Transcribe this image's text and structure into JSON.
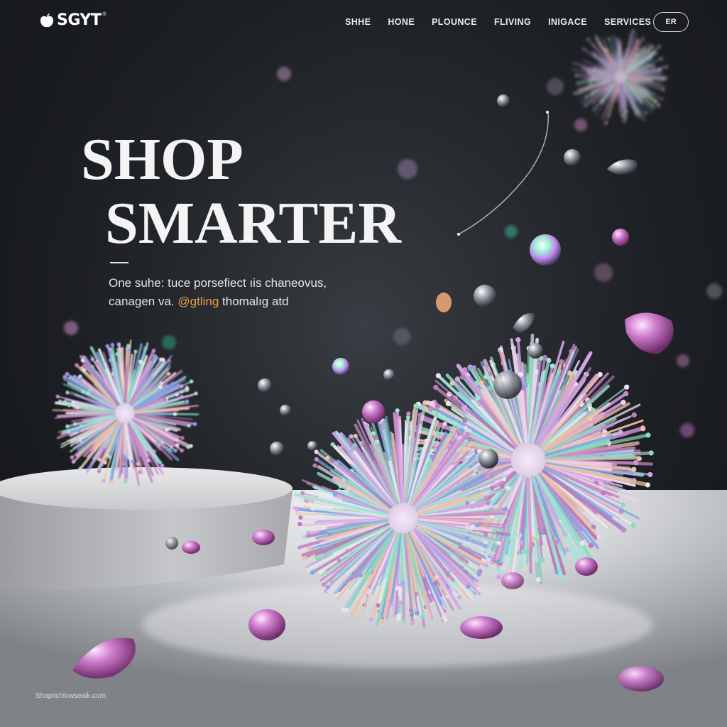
{
  "header": {
    "logo_text": "SGYT",
    "logo_tm": "®",
    "nav": [
      "SHHE",
      "HONE",
      "PLOUNCE",
      "FLIVING",
      "INIGACE",
      "SERVICES"
    ],
    "cta_label": "ER"
  },
  "hero": {
    "title_line1": "SHOP",
    "title_line2": "SMARTER",
    "subtitle_line1": "One suhe: tuce porsefiect ıis chaneovus,",
    "subtitle_line2_a": "canagen va.",
    "subtitle_line2_accent": "@gtling",
    "subtitle_line2_b": "thomalıg atd"
  },
  "footer": {
    "link": "Shapitchlowseaik.com"
  },
  "colors": {
    "background": "#1c1f23",
    "accent": "#e6a24f",
    "text": "#f4f4f4"
  }
}
